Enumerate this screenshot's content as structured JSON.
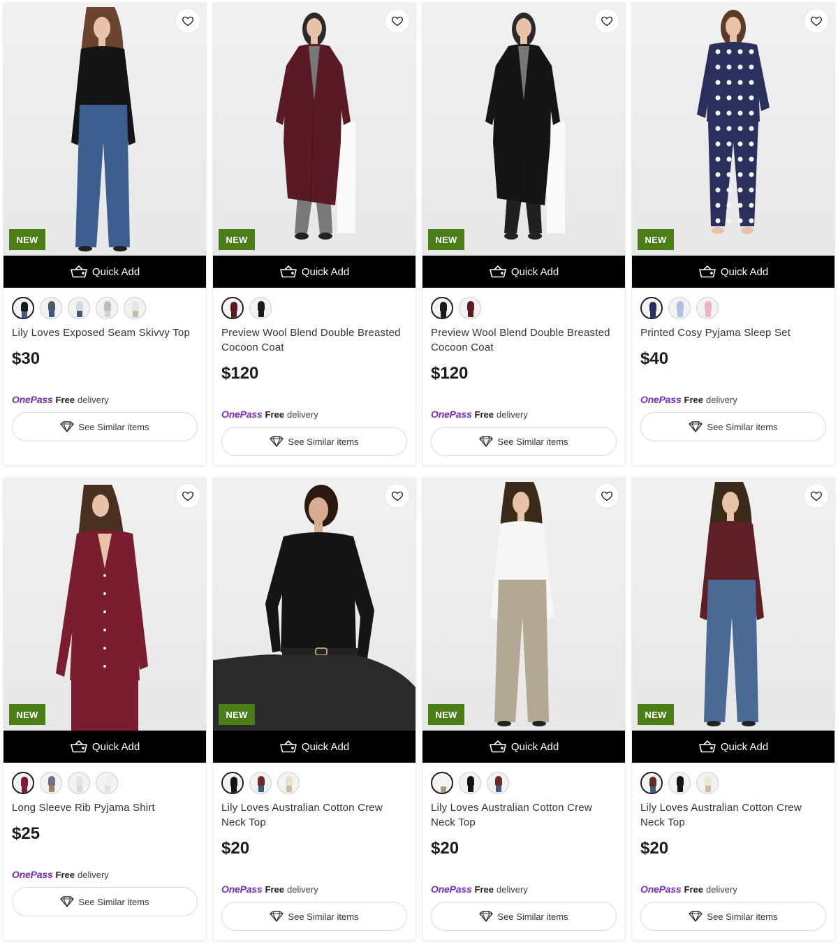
{
  "colors": {
    "new_badge": "#4b7e18",
    "quick_add_bg": "#000000",
    "onepass_brand": "#7a2bc2",
    "image_bg": "#efefef"
  },
  "products": [
    {
      "badge": "NEW",
      "quick_add_label": "Quick Add",
      "name": "Lily Loves Exposed Seam Skivvy Top",
      "price": "$30",
      "onepass": {
        "brand": "OnePass",
        "free": "Free",
        "delivery": "delivery"
      },
      "similar_label": "See Similar items",
      "swatches": [
        {
          "top": "#1a1a1a",
          "legs": "#3d5a80",
          "selected": true
        },
        {
          "top": "#4a5a6a",
          "legs": "#3d5a80",
          "selected": false
        },
        {
          "top": "#d8d8d8",
          "legs": "#3d5a80",
          "selected": false
        },
        {
          "top": "#bcbcbc",
          "legs": "#d4d4d4",
          "selected": false
        },
        {
          "top": "#e6e6e6",
          "legs": "#c8b9a3",
          "selected": false
        }
      ],
      "model": {
        "top": "#151515",
        "bottom": "#3d5f8f",
        "hair": "#6b4430",
        "style": "top-jeans"
      }
    },
    {
      "badge": "NEW",
      "quick_add_label": "Quick Add",
      "name": "Preview Wool Blend Double Breasted Cocoon Coat",
      "price": "$120",
      "onepass": {
        "brand": "OnePass",
        "free": "Free",
        "delivery": "delivery"
      },
      "similar_label": "See Similar items",
      "swatches": [
        {
          "top": "#5e1a24",
          "legs": "#5e1a24",
          "selected": true
        },
        {
          "top": "#1a1a1a",
          "legs": "#1a1a1a",
          "selected": false
        }
      ],
      "model": {
        "top": "#5a1a25",
        "bottom": "#7a7a7a",
        "hair": "#2a2a2a",
        "style": "coat"
      }
    },
    {
      "badge": "NEW",
      "quick_add_label": "Quick Add",
      "name": "Preview Wool Blend Double Breasted Cocoon Coat",
      "price": "$120",
      "onepass": {
        "brand": "OnePass",
        "free": "Free",
        "delivery": "delivery"
      },
      "similar_label": "See Similar items",
      "swatches": [
        {
          "top": "#1a1a1a",
          "legs": "#1a1a1a",
          "selected": true
        },
        {
          "top": "#5e1a24",
          "legs": "#5e1a24",
          "selected": false
        }
      ],
      "model": {
        "top": "#151515",
        "bottom": "#202020",
        "hair": "#2a2a2a",
        "style": "coat"
      }
    },
    {
      "badge": "NEW",
      "quick_add_label": "Quick Add",
      "name": "Printed Cosy Pyjama Sleep Set",
      "price": "$40",
      "onepass": {
        "brand": "OnePass",
        "free": "Free",
        "delivery": "delivery"
      },
      "similar_label": "See Similar items",
      "swatches": [
        {
          "top": "#2b2f5c",
          "legs": "#2b2f5c",
          "selected": true
        },
        {
          "top": "#a9c4dc",
          "legs": "#a9c4dc",
          "selected": false
        },
        {
          "top": "#e8b8c0",
          "legs": "#e8b8c0",
          "selected": false
        }
      ],
      "model": {
        "top": "#2b2f5c",
        "bottom": "#2b2f5c",
        "hair": "#5a3a28",
        "style": "pyjama"
      }
    },
    {
      "badge": "NEW",
      "quick_add_label": "Quick Add",
      "name": "Long Sleeve Rib Pyjama Shirt",
      "price": "$25",
      "onepass": {
        "brand": "OnePass",
        "free": "Free",
        "delivery": "delivery"
      },
      "similar_label": "See Similar items",
      "swatches": [
        {
          "top": "#7a1d2e",
          "legs": "#7a1d2e",
          "selected": true
        },
        {
          "top": "#7b6a8c",
          "legs": "#a08060",
          "selected": false
        },
        {
          "top": "#e4e4e4",
          "legs": "#d8d8d8",
          "selected": false
        },
        {
          "top": "#f0f0f0",
          "legs": "#e0e0e0",
          "selected": false
        }
      ],
      "model": {
        "top": "#7a1d2e",
        "bottom": "#7a1d2e",
        "hair": "#4a3020",
        "style": "shirt"
      }
    },
    {
      "badge": "NEW",
      "quick_add_label": "Quick Add",
      "name": "Lily Loves Australian Cotton Crew Neck Top",
      "price": "$20",
      "onepass": {
        "brand": "OnePass",
        "free": "Free",
        "delivery": "delivery"
      },
      "similar_label": "See Similar items",
      "swatches": [
        {
          "top": "#151515",
          "legs": "#151515",
          "selected": true
        },
        {
          "top": "#6b2a2a",
          "legs": "#3d5a80",
          "selected": false
        },
        {
          "top": "#e8e0d0",
          "legs": "#c8b9a3",
          "selected": false
        }
      ],
      "model": {
        "top": "#151515",
        "bottom": "#2a2a2a",
        "hair": "#2a1a10",
        "style": "seated"
      }
    },
    {
      "badge": "NEW",
      "quick_add_label": "Quick Add",
      "name": "Lily Loves Australian Cotton Crew Neck Top",
      "price": "$20",
      "onepass": {
        "brand": "OnePass",
        "free": "Free",
        "delivery": "delivery"
      },
      "similar_label": "See Similar items",
      "swatches": [
        {
          "top": "#f4f4f4",
          "legs": "#a89a85",
          "selected": true
        },
        {
          "top": "#151515",
          "legs": "#151515",
          "selected": false
        },
        {
          "top": "#6b2a2a",
          "legs": "#3d5a80",
          "selected": false
        }
      ],
      "model": {
        "top": "#f6f6f6",
        "bottom": "#b3a894",
        "hair": "#3a2a1a",
        "style": "top-pants"
      }
    },
    {
      "badge": "NEW",
      "quick_add_label": "Quick Add",
      "name": "Lily Loves Australian Cotton Crew Neck Top",
      "price": "$20",
      "onepass": {
        "brand": "OnePass",
        "free": "Free",
        "delivery": "delivery"
      },
      "similar_label": "See Similar items",
      "swatches": [
        {
          "top": "#6b2a2a",
          "legs": "#3d5a80",
          "selected": true
        },
        {
          "top": "#151515",
          "legs": "#151515",
          "selected": false
        },
        {
          "top": "#efe8d8",
          "legs": "#c8b9a3",
          "selected": false
        }
      ],
      "model": {
        "top": "#5e1f26",
        "bottom": "#4a6a95",
        "hair": "#3a2a1a",
        "style": "top-jeans"
      }
    }
  ]
}
